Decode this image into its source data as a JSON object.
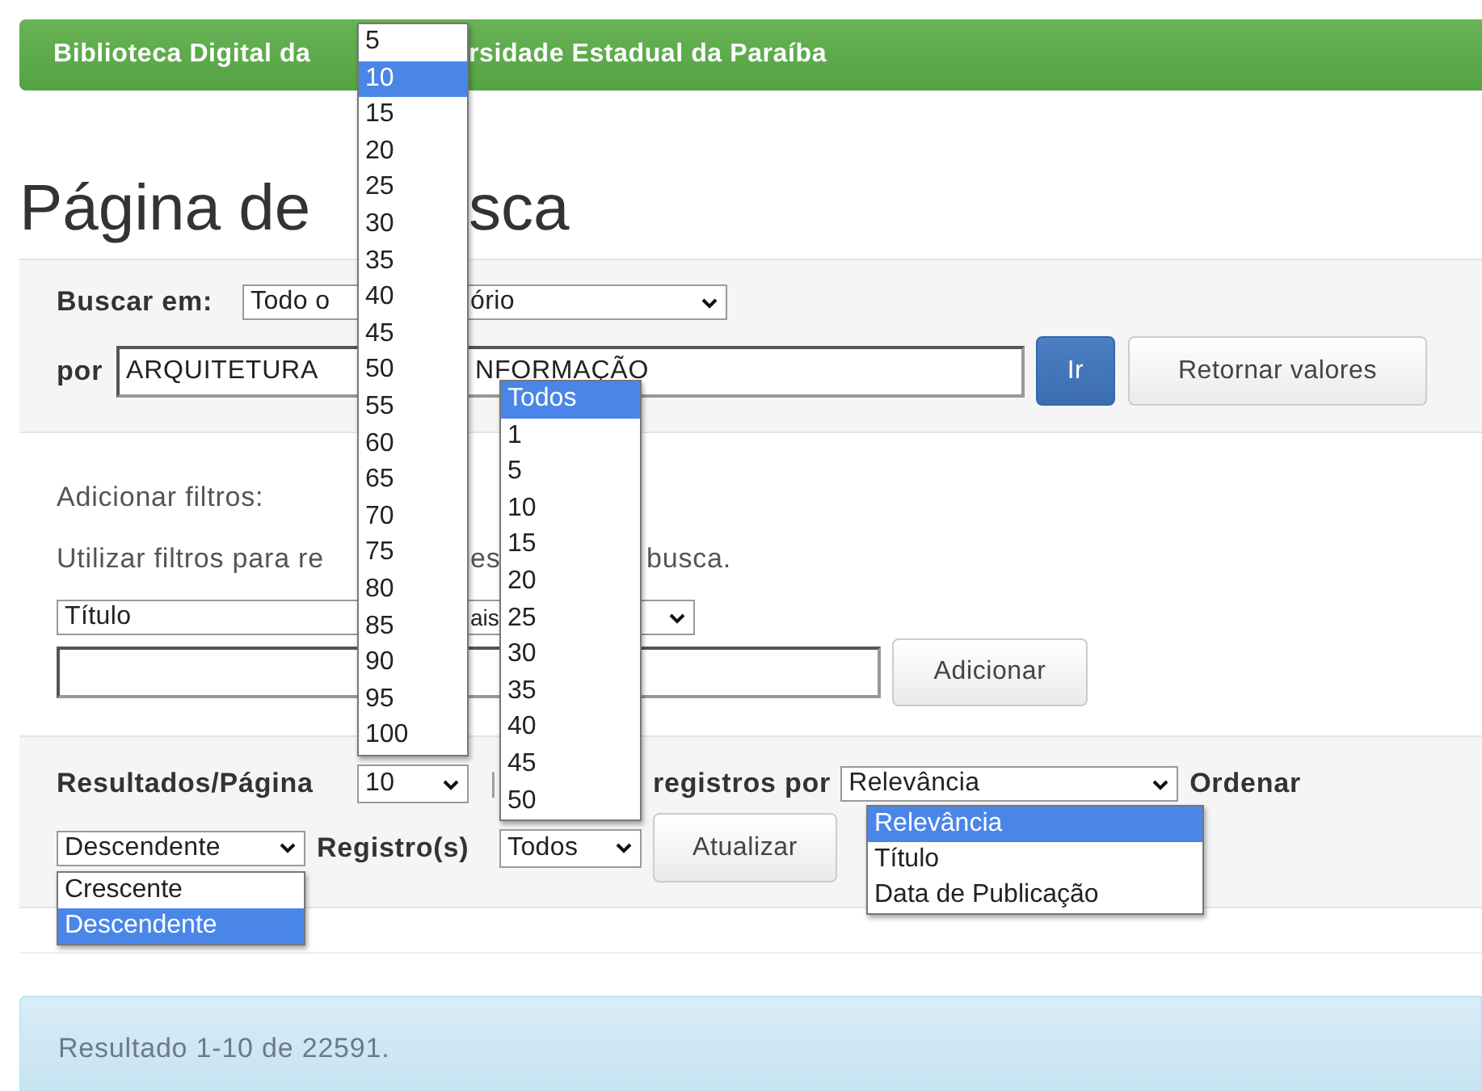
{
  "header": {
    "title_parts": [
      "Biblioteca Digital da",
      "rsidade Estadual da Paraíba"
    ]
  },
  "heading_parts": [
    "Página de",
    "sca"
  ],
  "search": {
    "scope_label": "Buscar em:",
    "scope_parts": [
      "Todo o",
      "ório"
    ],
    "query_label": "por",
    "query_parts": [
      "ARQUITETURA",
      "NFORMAÇÃO"
    ],
    "buttons": [
      {
        "label": "Ir",
        "kind": "primary"
      },
      {
        "label": "Retornar valores",
        "kind": "default"
      }
    ]
  },
  "filters": {
    "title": "Adicionar filtros:",
    "hint_parts": [
      "Utilizar filtros para re",
      "es",
      "busca."
    ],
    "field": "Título",
    "operator_part": "ais",
    "button": "Adicionar"
  },
  "controls": {
    "rpp_label": "Resultados/Página",
    "rpp_value": "10",
    "separator": "|",
    "sort_label": "registros por",
    "sort_value": "Relevância",
    "order_label": "Ordenar",
    "order_value": "Descendente",
    "records_label": "Registro(s)",
    "records_value": "Todos",
    "update_button": "Atualizar"
  },
  "menus": [
    {
      "kind": "rpp",
      "options": [
        {
          "label": "5",
          "selected": false
        },
        {
          "label": "10",
          "selected": true
        },
        {
          "label": "15",
          "selected": false
        },
        {
          "label": "20",
          "selected": false
        },
        {
          "label": "25",
          "selected": false
        },
        {
          "label": "30",
          "selected": false
        },
        {
          "label": "35",
          "selected": false
        },
        {
          "label": "40",
          "selected": false
        },
        {
          "label": "45",
          "selected": false
        },
        {
          "label": "50",
          "selected": false
        },
        {
          "label": "55",
          "selected": false
        },
        {
          "label": "60",
          "selected": false
        },
        {
          "label": "65",
          "selected": false
        },
        {
          "label": "70",
          "selected": false
        },
        {
          "label": "75",
          "selected": false
        },
        {
          "label": "80",
          "selected": false
        },
        {
          "label": "85",
          "selected": false
        },
        {
          "label": "90",
          "selected": false
        },
        {
          "label": "95",
          "selected": false
        },
        {
          "label": "100",
          "selected": false
        }
      ]
    },
    {
      "kind": "records",
      "options": [
        {
          "label": "Todos",
          "selected": true
        },
        {
          "label": "1",
          "selected": false
        },
        {
          "label": "5",
          "selected": false
        },
        {
          "label": "10",
          "selected": false
        },
        {
          "label": "15",
          "selected": false
        },
        {
          "label": "20",
          "selected": false
        },
        {
          "label": "25",
          "selected": false
        },
        {
          "label": "30",
          "selected": false
        },
        {
          "label": "35",
          "selected": false
        },
        {
          "label": "40",
          "selected": false
        },
        {
          "label": "45",
          "selected": false
        },
        {
          "label": "50",
          "selected": false
        }
      ]
    },
    {
      "kind": "sort",
      "options": [
        {
          "label": "Relevância",
          "selected": true
        },
        {
          "label": "Título",
          "selected": false
        },
        {
          "label": "Data de Publicação",
          "selected": false
        }
      ]
    },
    {
      "kind": "order",
      "options": [
        {
          "label": "Crescente",
          "selected": false
        },
        {
          "label": "Descendente",
          "selected": true
        }
      ]
    }
  ],
  "result": "Resultado 1-10 de 22591."
}
